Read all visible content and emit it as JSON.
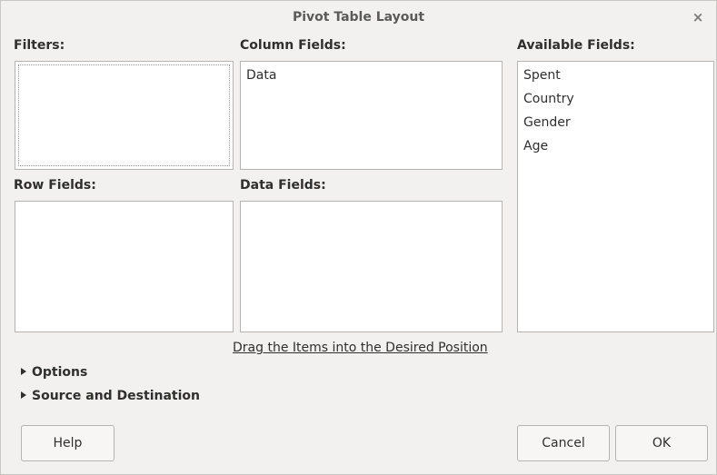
{
  "window": {
    "title": "Pivot Table Layout",
    "close_glyph": "×"
  },
  "filters": {
    "label": "Filters:",
    "items": []
  },
  "column_fields": {
    "label": "Column Fields:",
    "items": [
      "Data"
    ]
  },
  "row_fields": {
    "label": "Row Fields:",
    "items": []
  },
  "data_fields": {
    "label": "Data Fields:",
    "items": []
  },
  "available_fields": {
    "label": "Available Fields:",
    "items": [
      "Spent",
      "Country",
      "Gender",
      "Age"
    ]
  },
  "hint_text": "Drag the Items into the Desired Position",
  "expanders": {
    "options": "Options",
    "source_destination": "Source and Destination"
  },
  "buttons": {
    "help": "Help",
    "cancel": "Cancel",
    "ok": "OK"
  }
}
